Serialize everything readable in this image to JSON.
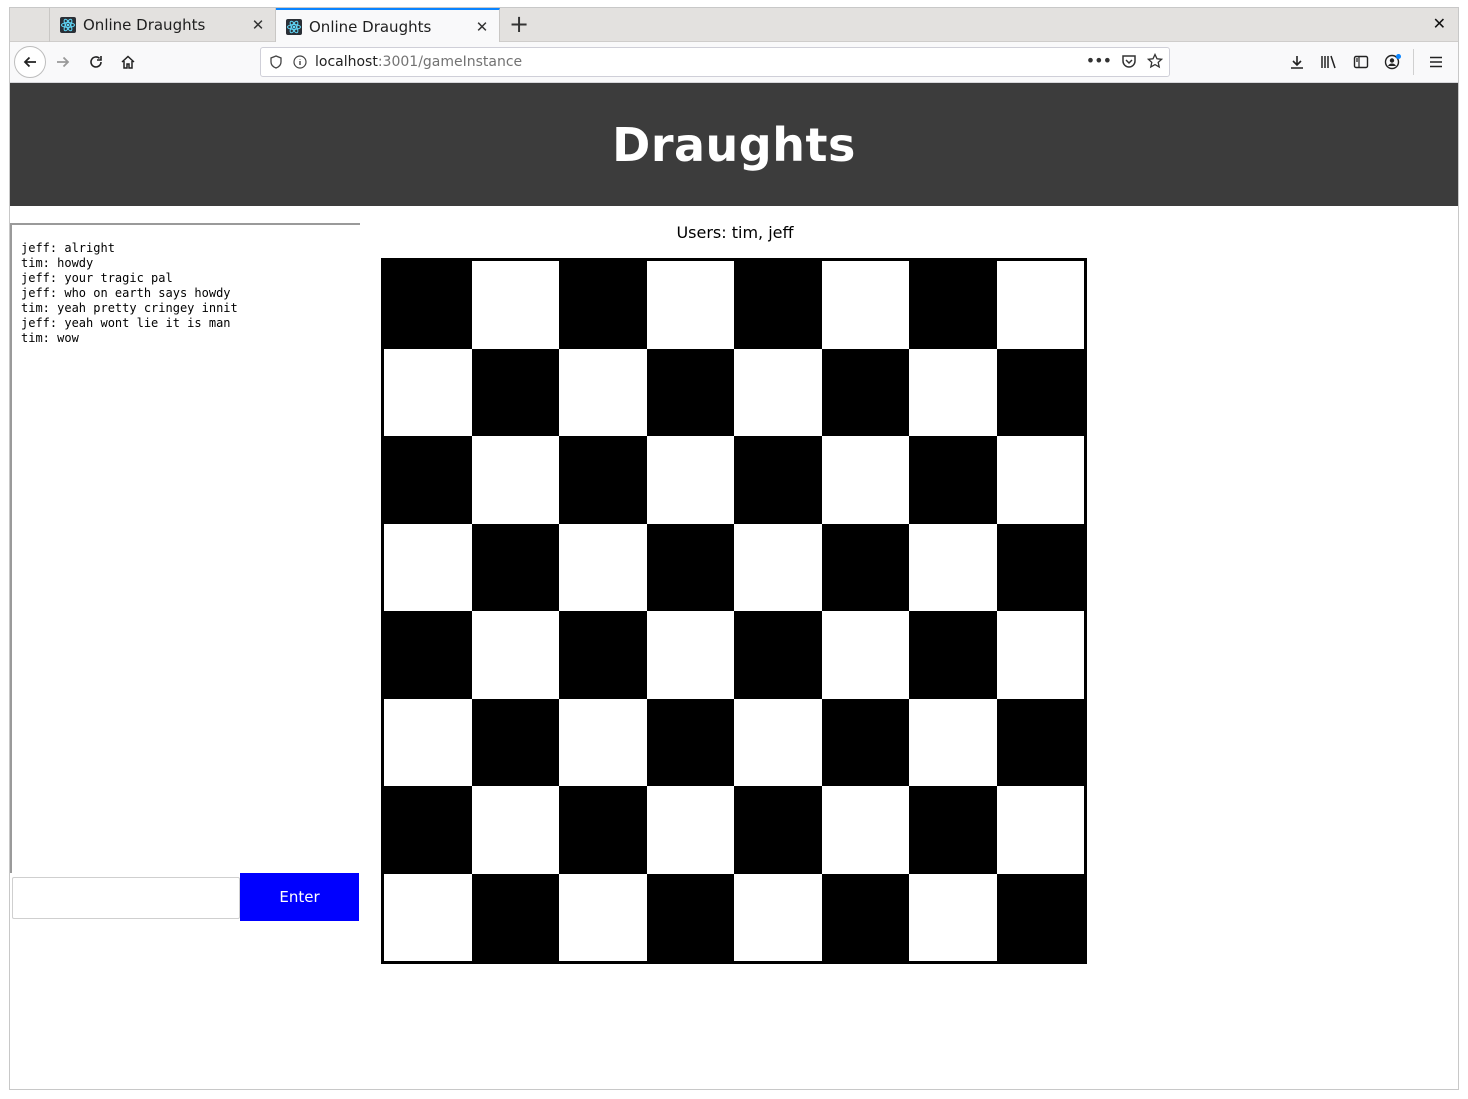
{
  "browser": {
    "tabs": [
      {
        "title": "Online Draughts",
        "active": false
      },
      {
        "title": "Online Draughts",
        "active": true
      }
    ],
    "url_host": "localhost",
    "url_path": ":3001/gameInstance"
  },
  "header": {
    "title": "Draughts"
  },
  "users_label": "Users: tim, jeff",
  "chat": {
    "messages": [
      "jeff: alright",
      "tim: howdy",
      "jeff: your tragic pal",
      "jeff: who on earth says howdy",
      "tim: yeah pretty cringey innit",
      "jeff: yeah wont lie it is man",
      "tim: wow"
    ],
    "input_value": "",
    "enter_label": "Enter"
  },
  "board": {
    "size": 8,
    "top_left_color": "dark",
    "dark_color": "#000000",
    "light_color": "#ffffff"
  },
  "colors": {
    "header_bg": "#3c3c3c",
    "enter_button_bg": "#0000ff",
    "active_tab_accent": "#0a84ff"
  }
}
